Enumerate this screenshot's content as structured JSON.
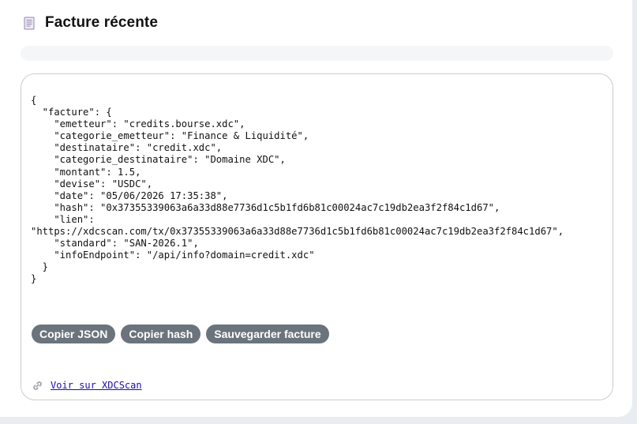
{
  "header": {
    "title": "Facture récente",
    "icon": "document-icon"
  },
  "progress": {
    "value": 0
  },
  "invoice": {
    "json_text": "{\n  \"facture\": {\n    \"emetteur\": \"credits.bourse.xdc\",\n    \"categorie_emetteur\": \"Finance & Liquidité\",\n    \"destinataire\": \"credit.xdc\",\n    \"categorie_destinataire\": \"Domaine XDC\",\n    \"montant\": 1.5,\n    \"devise\": \"USDC\",\n    \"date\": \"05/06/2026 17:35:38\",\n    \"hash\": \"0x37355339063a6a33d88e7736d1c5b1fd6b81c00024ac7c19db2ea3f2f84c1d67\",\n    \"lien\":\n\"https://xdcscan.com/tx/0x37355339063a6a33d88e7736d1c5b1fd6b81c00024ac7c19db2ea3f2f84c1d67\",\n    \"standard\": \"SAN-2026.1\",\n    \"infoEndpoint\": \"/api/info?domain=credit.xdc\"\n  }\n}"
  },
  "actions": {
    "copy_json": "Copier JSON",
    "copy_hash": "Copier hash",
    "save_invoice": "Sauvegarder facture"
  },
  "link": {
    "icon": "link-icon",
    "label": "Voir sur XDCScan"
  },
  "colors": {
    "button_bg": "#6b747c",
    "link": "#1a0dab",
    "panel_border": "#c9cdd2",
    "page_bg": "#e9ecf0"
  }
}
